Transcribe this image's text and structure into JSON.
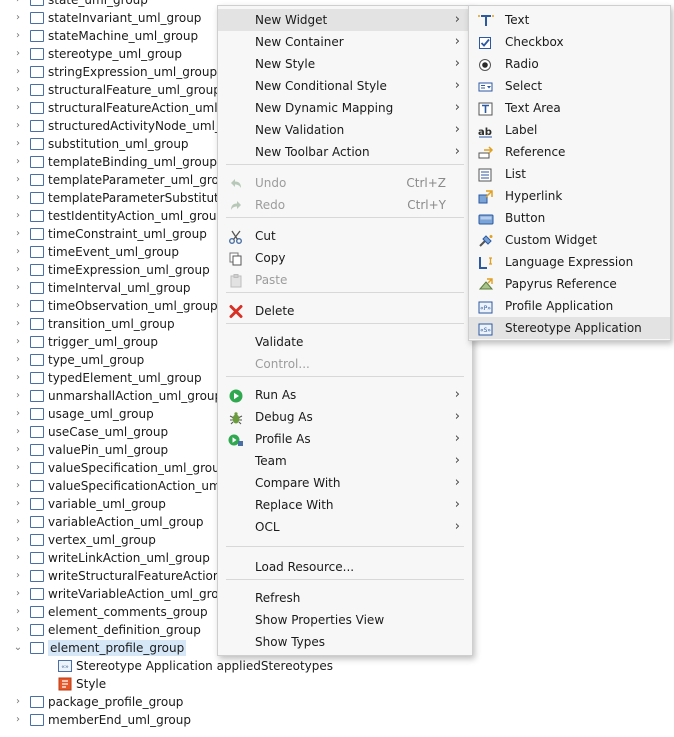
{
  "tree": {
    "items": [
      {
        "label": "state_uml_group"
      },
      {
        "label": "stateInvariant_uml_group"
      },
      {
        "label": "stateMachine_uml_group"
      },
      {
        "label": "stereotype_uml_group"
      },
      {
        "label": "stringExpression_uml_group"
      },
      {
        "label": "structuralFeature_uml_group"
      },
      {
        "label": "structuralFeatureAction_uml_"
      },
      {
        "label": "structuredActivityNode_uml_g"
      },
      {
        "label": "substitution_uml_group"
      },
      {
        "label": "templateBinding_uml_group"
      },
      {
        "label": "templateParameter_uml_group"
      },
      {
        "label": "templateParameterSubstitutio"
      },
      {
        "label": "testIdentityAction_uml_group"
      },
      {
        "label": "timeConstraint_uml_group"
      },
      {
        "label": "timeEvent_uml_group"
      },
      {
        "label": "timeExpression_uml_group"
      },
      {
        "label": "timeInterval_uml_group"
      },
      {
        "label": "timeObservation_uml_group"
      },
      {
        "label": "transition_uml_group"
      },
      {
        "label": "trigger_uml_group"
      },
      {
        "label": "type_uml_group"
      },
      {
        "label": "typedElement_uml_group"
      },
      {
        "label": "unmarshallAction_uml_group"
      },
      {
        "label": "usage_uml_group"
      },
      {
        "label": "useCase_uml_group"
      },
      {
        "label": "valuePin_uml_group"
      },
      {
        "label": "valueSpecification_uml_group"
      },
      {
        "label": "valueSpecificationAction_uml"
      },
      {
        "label": "variable_uml_group"
      },
      {
        "label": "variableAction_uml_group"
      },
      {
        "label": "vertex_uml_group"
      },
      {
        "label": "writeLinkAction_uml_group"
      },
      {
        "label": "writeStructuralFeatureAction_"
      },
      {
        "label": "writeVariableAction_uml_group"
      },
      {
        "label": "element_comments_group"
      },
      {
        "label": "element_definition_group"
      },
      {
        "label": "element_profile_group"
      },
      {
        "label": "package_profile_group"
      },
      {
        "label": "memberEnd_uml_group"
      }
    ],
    "children": [
      {
        "label": "Stereotype Application appliedStereotypes",
        "icon": "stereotype-icon"
      },
      {
        "label": "Style",
        "icon": "style-icon"
      }
    ]
  },
  "context_menu": {
    "items": [
      {
        "label": "New Widget",
        "sub": true
      },
      {
        "label": "New Container",
        "sub": true
      },
      {
        "label": "New Style",
        "sub": true
      },
      {
        "label": "New Conditional Style",
        "sub": true
      },
      {
        "label": "New Dynamic Mapping",
        "sub": true
      },
      {
        "label": "New Validation",
        "sub": true
      },
      {
        "label": "New Toolbar Action",
        "sub": true
      },
      {
        "label": "Undo",
        "shortcut": "Ctrl+Z",
        "disabled": true,
        "icon": "undo-icon"
      },
      {
        "label": "Redo",
        "shortcut": "Ctrl+Y",
        "disabled": true,
        "icon": "redo-icon"
      },
      {
        "label": "Cut",
        "icon": "cut-icon"
      },
      {
        "label": "Copy",
        "icon": "copy-icon"
      },
      {
        "label": "Paste",
        "disabled": true,
        "icon": "paste-icon"
      },
      {
        "label": "Delete",
        "icon": "delete-icon"
      },
      {
        "label": "Validate"
      },
      {
        "label": "Control...",
        "disabled": true
      },
      {
        "label": "Run As",
        "sub": true,
        "icon": "run-icon"
      },
      {
        "label": "Debug As",
        "sub": true,
        "icon": "debug-icon"
      },
      {
        "label": "Profile As",
        "sub": true,
        "icon": "profile-icon"
      },
      {
        "label": "Team",
        "sub": true
      },
      {
        "label": "Compare With",
        "sub": true
      },
      {
        "label": "Replace With",
        "sub": true
      },
      {
        "label": "OCL",
        "sub": true
      },
      {
        "label": "Load Resource..."
      },
      {
        "label": "Refresh"
      },
      {
        "label": "Show Properties View"
      },
      {
        "label": "Show Types"
      }
    ]
  },
  "widget_submenu": {
    "items": [
      {
        "label": "Text",
        "icon": "text-widget-icon"
      },
      {
        "label": "Checkbox",
        "icon": "checkbox-icon"
      },
      {
        "label": "Radio",
        "icon": "radio-icon"
      },
      {
        "label": "Select",
        "icon": "select-icon"
      },
      {
        "label": "Text Area",
        "icon": "text-area-icon"
      },
      {
        "label": "Label",
        "icon": "label-icon"
      },
      {
        "label": "Reference",
        "icon": "reference-icon"
      },
      {
        "label": "List",
        "icon": "list-icon"
      },
      {
        "label": "Hyperlink",
        "icon": "hyperlink-icon"
      },
      {
        "label": "Button",
        "icon": "button-icon"
      },
      {
        "label": "Custom Widget",
        "icon": "custom-widget-icon"
      },
      {
        "label": "Language Expression",
        "icon": "language-expression-icon"
      },
      {
        "label": "Papyrus Reference",
        "icon": "papyrus-reference-icon"
      },
      {
        "label": "Profile Application",
        "icon": "profile-application-icon"
      },
      {
        "label": "Stereotype Application",
        "icon": "stereotype-application-icon"
      }
    ]
  },
  "colors": {
    "selection": "#d6e7f7",
    "menu_bg": "#f7f7f7",
    "highlight": "#e3e3e3",
    "disabled_text": "#9c9c9c"
  }
}
